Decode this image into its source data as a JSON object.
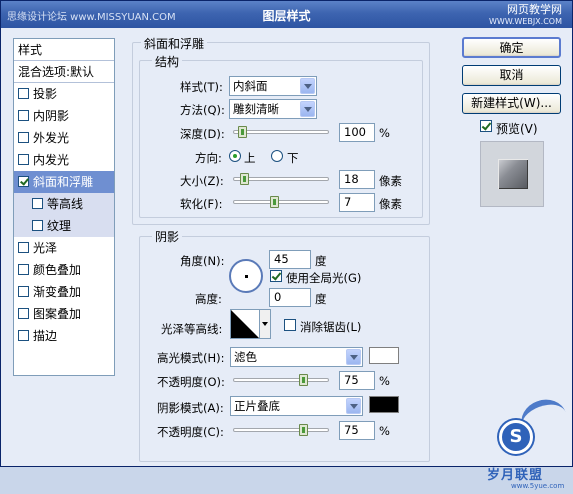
{
  "window": {
    "title": "图层样式",
    "watermark_left": "思缘设计论坛 www.MISSYUAN.COM",
    "watermark_right_main": "网页教学网",
    "watermark_right_url": "WWW.WEBJX.COM"
  },
  "sidebar": {
    "header": "样式",
    "blend": "混合选项:默认",
    "items": [
      {
        "label": "投影",
        "checked": false
      },
      {
        "label": "内阴影",
        "checked": false
      },
      {
        "label": "外发光",
        "checked": false
      },
      {
        "label": "内发光",
        "checked": false
      },
      {
        "label": "斜面和浮雕",
        "checked": true
      },
      {
        "label": "等高线",
        "checked": false
      },
      {
        "label": "纹理",
        "checked": false
      },
      {
        "label": "光泽",
        "checked": false
      },
      {
        "label": "颜色叠加",
        "checked": false
      },
      {
        "label": "渐变叠加",
        "checked": false
      },
      {
        "label": "图案叠加",
        "checked": false
      },
      {
        "label": "描边",
        "checked": false
      }
    ]
  },
  "bevel": {
    "title": "斜面和浮雕",
    "structure_title": "结构",
    "style_label": "样式(T):",
    "style_value": "内斜面",
    "technique_label": "方法(Q):",
    "technique_value": "雕刻清晰",
    "depth_label": "深度(D):",
    "depth_value": "100",
    "depth_unit": "%",
    "depth_level": 0.05,
    "direction_label": "方向:",
    "dir_up": "上",
    "dir_down": "下",
    "size_label": "大小(Z):",
    "size_value": "18",
    "size_unit": "像素",
    "size_level": 0.07,
    "soften_label": "软化(F):",
    "soften_value": "7",
    "soften_unit": "像素",
    "soften_level": 0.42
  },
  "shading": {
    "title": "阴影",
    "angle_label": "角度(N):",
    "angle_value": "45",
    "angle_unit": "度",
    "global_light": "使用全局光(G)",
    "altitude_label": "高度:",
    "altitude_value": "0",
    "altitude_unit": "度",
    "gloss_label": "光泽等高线:",
    "antialias": "消除锯齿(L)",
    "highlight_label": "高光模式(H):",
    "highlight_mode": "滤色",
    "highlight_color": "#ffffff",
    "hl_opacity_label": "不透明度(O):",
    "hl_opacity_value": "75",
    "hl_opacity_unit": "%",
    "hl_opacity_level": 0.75,
    "shadow_label": "阴影模式(A):",
    "shadow_mode": "正片叠底",
    "shadow_color": "#000000",
    "sh_opacity_label": "不透明度(C):",
    "sh_opacity_value": "75",
    "sh_opacity_unit": "%",
    "sh_opacity_level": 0.75
  },
  "buttons": {
    "ok": "确定",
    "cancel": "取消",
    "new_style": "新建样式(W)...",
    "preview": "预览(V)"
  },
  "logo": {
    "letter": "S",
    "text": "岁月联盟",
    "url": "www.5yue.com"
  }
}
